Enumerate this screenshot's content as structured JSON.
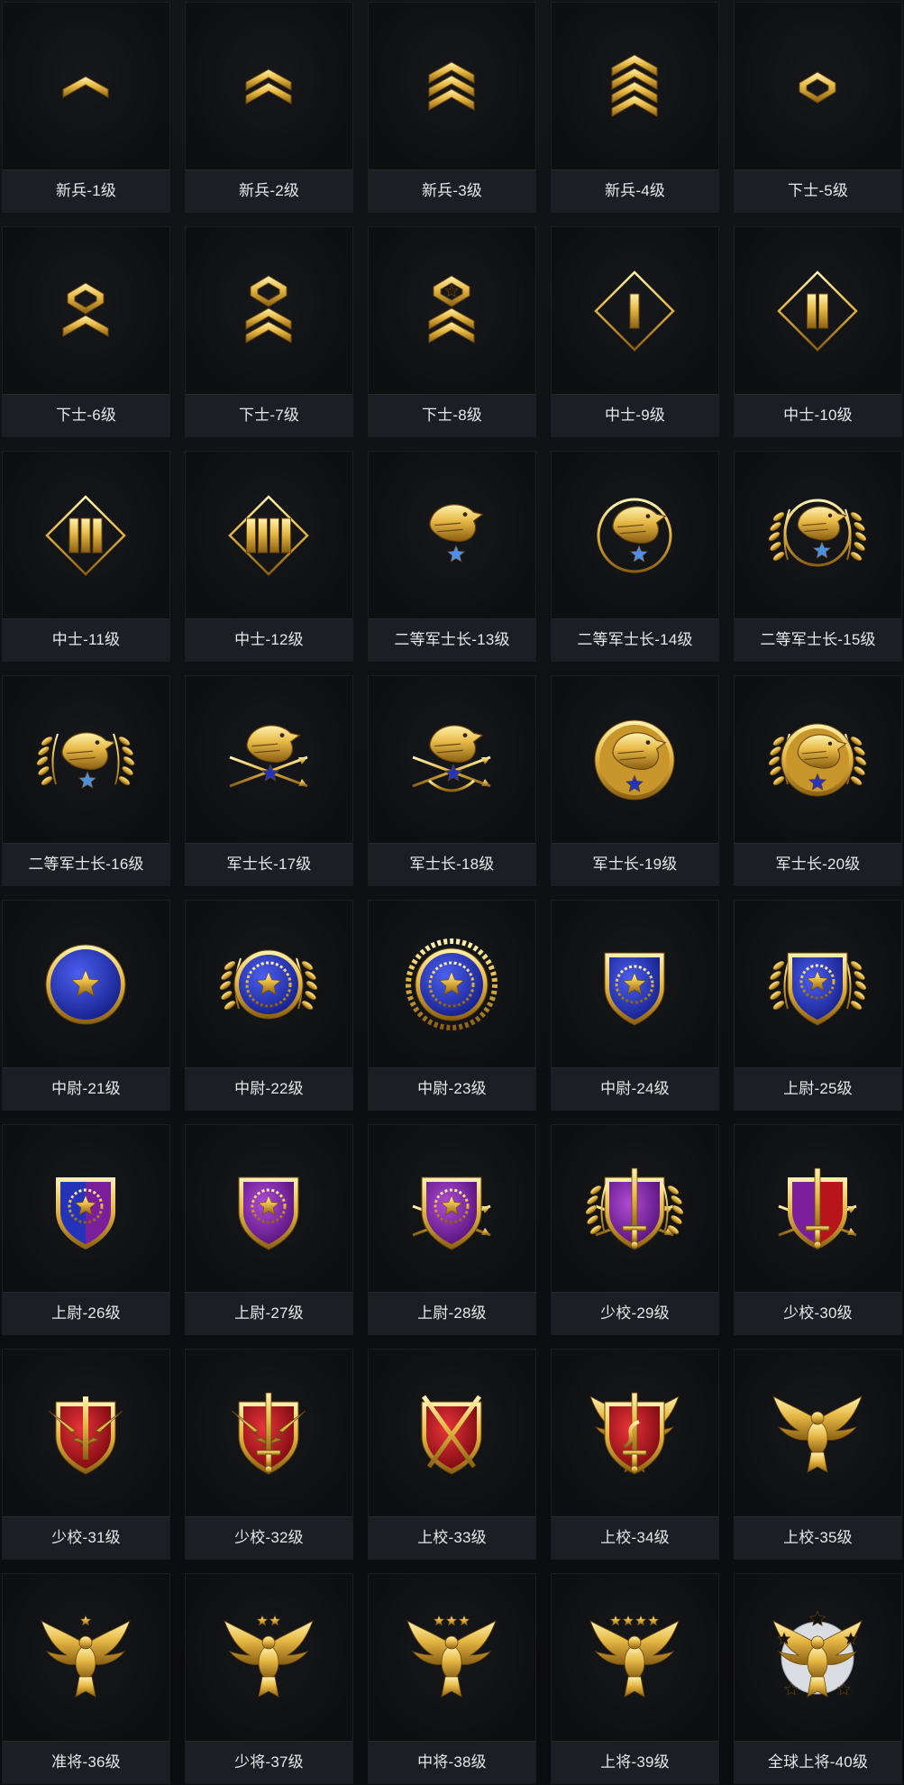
{
  "colors": {
    "gold": "#e0b44a",
    "gold_light": "#fbe79a",
    "gold_dark": "#8a5f12",
    "blue": "#2433b8",
    "purple": "#7a1e9c",
    "red": "#b8141c",
    "star_blue": "#4f8fe0",
    "label_bg": "#1b1e22",
    "card_bg": "#101114"
  },
  "ranks": [
    {
      "label": "新兵-1级",
      "icon": "chevron-1-icon"
    },
    {
      "label": "新兵-2级",
      "icon": "chevron-2-icon"
    },
    {
      "label": "新兵-3级",
      "icon": "chevron-3-icon"
    },
    {
      "label": "新兵-4级",
      "icon": "chevron-4-icon"
    },
    {
      "label": "下士-5级",
      "icon": "diamond-loop-icon"
    },
    {
      "label": "下士-6级",
      "icon": "loop-chevron-1-icon"
    },
    {
      "label": "下士-7级",
      "icon": "loop-chevron-2-icon"
    },
    {
      "label": "下士-8级",
      "icon": "star-loop-chevron-icon"
    },
    {
      "label": "中士-9级",
      "icon": "diamond-bar-1-icon"
    },
    {
      "label": "中士-10级",
      "icon": "diamond-bar-2-icon"
    },
    {
      "label": "中士-11级",
      "icon": "diamond-bar-3-icon"
    },
    {
      "label": "中士-12级",
      "icon": "diamond-bar-4-icon"
    },
    {
      "label": "二等军士长-13级",
      "icon": "eagle-star-icon"
    },
    {
      "label": "二等军士长-14级",
      "icon": "eagle-ring-icon"
    },
    {
      "label": "二等军士长-15级",
      "icon": "eagle-ring-laurel-icon"
    },
    {
      "label": "二等军士长-16级",
      "icon": "eagle-laurel-icon"
    },
    {
      "label": "军士长-17级",
      "icon": "eagle-arrows-icon"
    },
    {
      "label": "军士长-18级",
      "icon": "eagle-arrows-laurel-icon"
    },
    {
      "label": "军士长-19级",
      "icon": "eagle-medal-icon"
    },
    {
      "label": "军士长-20级",
      "icon": "eagle-medal-laurel-icon"
    },
    {
      "label": "中尉-21级",
      "icon": "blue-star-disc-icon"
    },
    {
      "label": "中尉-22级",
      "icon": "blue-gear-disc-laurel-icon"
    },
    {
      "label": "中尉-23级",
      "icon": "blue-gear-disc-wreath-icon"
    },
    {
      "label": "中尉-24级",
      "icon": "blue-gear-shield-icon"
    },
    {
      "label": "上尉-25级",
      "icon": "blue-gear-shield-laurel-icon"
    },
    {
      "label": "上尉-26级",
      "icon": "blue-purple-shield-laurel-icon"
    },
    {
      "label": "上尉-27级",
      "icon": "purple-shield-arrow-icon"
    },
    {
      "label": "上尉-28级",
      "icon": "purple-shield-arrows-icon"
    },
    {
      "label": "少校-29级",
      "icon": "purple-shield-sword-icon"
    },
    {
      "label": "少校-30级",
      "icon": "purple-red-shield-sword-icon"
    },
    {
      "label": "少校-31级",
      "icon": "red-shield-lightning-icon"
    },
    {
      "label": "少校-32级",
      "icon": "red-shield-sword-lightning-icon"
    },
    {
      "label": "上校-33级",
      "icon": "red-shield-crossed-swords-icon"
    },
    {
      "label": "上校-34级",
      "icon": "red-shield-snake-wings-icon"
    },
    {
      "label": "上校-35级",
      "icon": "spread-eagle-icon"
    },
    {
      "label": "准将-36级",
      "icon": "eagle-1-star-icon"
    },
    {
      "label": "少将-37级",
      "icon": "eagle-2-star-icon"
    },
    {
      "label": "中将-38级",
      "icon": "eagle-3-star-icon"
    },
    {
      "label": "上将-39级",
      "icon": "eagle-4-star-icon"
    },
    {
      "label": "全球上将-40级",
      "icon": "eagle-5-star-globe-icon"
    }
  ]
}
